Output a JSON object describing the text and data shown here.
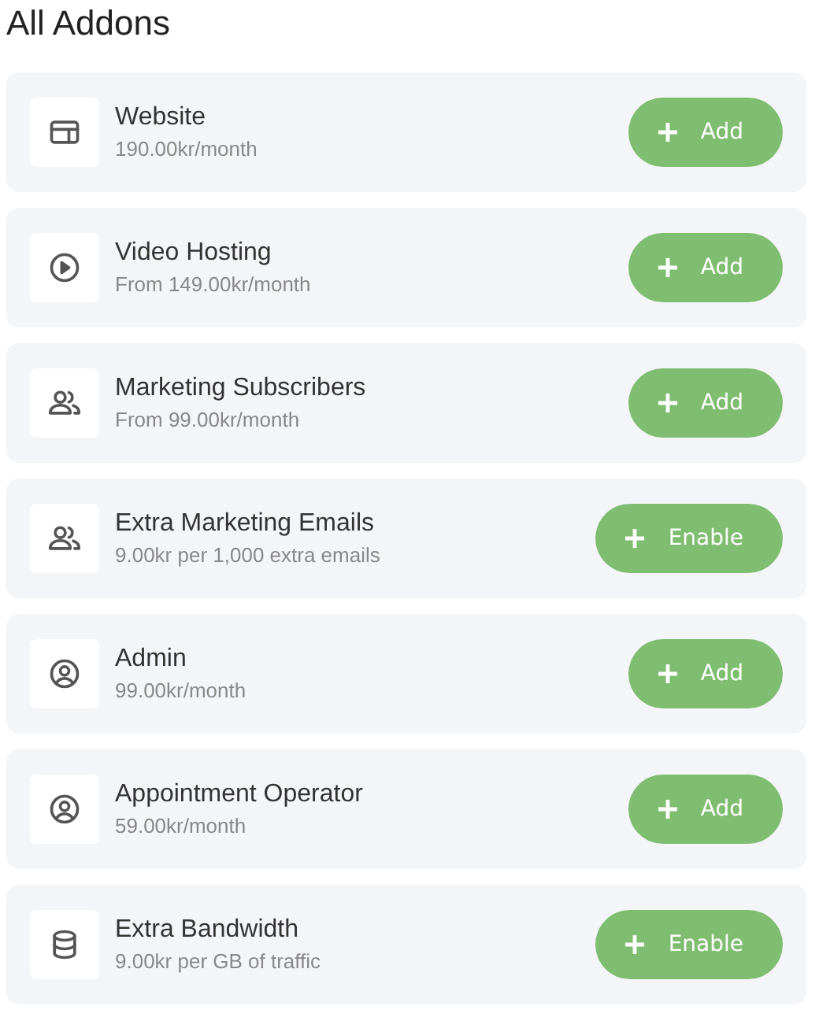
{
  "heading": "All Addons",
  "addons": [
    {
      "kind": "layout",
      "name": "Website",
      "price": "190.00kr/month",
      "action": "Add"
    },
    {
      "kind": "play",
      "name": "Video Hosting",
      "price": "From 149.00kr/month",
      "action": "Add"
    },
    {
      "kind": "people",
      "name": "Marketing Subscribers",
      "price": "From 99.00kr/month",
      "action": "Add"
    },
    {
      "kind": "people",
      "name": "Extra Marketing Emails",
      "price": "9.00kr per 1,000 extra emails",
      "action": "Enable"
    },
    {
      "kind": "user",
      "name": "Admin",
      "price": "99.00kr/month",
      "action": "Add"
    },
    {
      "kind": "user",
      "name": "Appointment Operator",
      "price": "59.00kr/month",
      "action": "Add"
    },
    {
      "kind": "database",
      "name": "Extra Bandwidth",
      "price": "9.00kr per GB of traffic",
      "action": "Enable"
    }
  ]
}
